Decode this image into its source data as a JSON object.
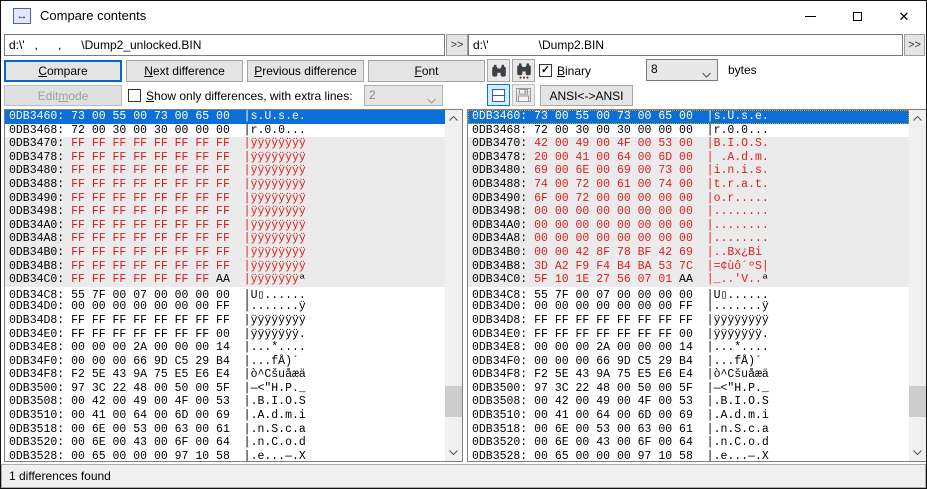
{
  "titlebar": {
    "title": "Compare contents"
  },
  "icons": {
    "compare_arrows": "↔",
    "close": "✕",
    "check": "✓",
    "chevron_down": "⌄"
  },
  "paths": {
    "left": {
      "value": "d:\\'   ,      ,      \\Dump2_unlocked.BIN",
      "expand_label": ">>"
    },
    "right": {
      "value": "d:\\'               \\Dump2.BIN",
      "expand_label": ">>"
    }
  },
  "toolbar": {
    "compare": {
      "label": "Compare",
      "m": 0
    },
    "next": {
      "label": "Next difference",
      "m": 0
    },
    "previous": {
      "label": "Previous difference",
      "m": 0
    },
    "font": {
      "label": "Font",
      "m": 0
    },
    "edit_mode": {
      "label": "Edit mode",
      "m": 5
    },
    "show_only": {
      "label": "Show only differences, with extra lines:",
      "m": 0
    },
    "show_only_checked": false,
    "extra_lines_value": "2",
    "binary": {
      "label": "Binary",
      "m": 0
    },
    "binary_checked": true,
    "bytes_value": "8",
    "bytes_label": "bytes",
    "ansi_label": "ANSI<->ANSI"
  },
  "status": {
    "text": "1 differences found"
  },
  "hex": {
    "left_rows": [
      {
        "a": "0DB3460:",
        "h": [
          [
            "73 00 55 00 73 00 65 00",
            "w"
          ]
        ],
        "t": [
          [
            "|s.U.s.e.",
            "w"
          ]
        ],
        "bg": "sel"
      },
      {
        "a": "0DB3468:",
        "h": [
          [
            "72 00 30 00 30 00 00 00",
            "k"
          ]
        ],
        "t": [
          [
            "|r.0.0...",
            "k"
          ]
        ],
        "bg": "plain"
      },
      {
        "a": "0DB3470:",
        "h": [
          [
            "FF FF FF FF FF FF FF FF",
            "r"
          ]
        ],
        "t": [
          [
            "|ÿÿÿÿÿÿÿÿ",
            "r"
          ]
        ],
        "bg": "gray"
      },
      {
        "a": "0DB3478:",
        "h": [
          [
            "FF FF FF FF FF FF FF FF",
            "r"
          ]
        ],
        "t": [
          [
            "|ÿÿÿÿÿÿÿÿ",
            "r"
          ]
        ],
        "bg": "gray"
      },
      {
        "a": "0DB3480:",
        "h": [
          [
            "FF FF FF FF FF FF FF FF",
            "r"
          ]
        ],
        "t": [
          [
            "|ÿÿÿÿÿÿÿÿ",
            "r"
          ]
        ],
        "bg": "gray"
      },
      {
        "a": "0DB3488:",
        "h": [
          [
            "FF FF FF FF FF FF FF FF",
            "r"
          ]
        ],
        "t": [
          [
            "|ÿÿÿÿÿÿÿÿ",
            "r"
          ]
        ],
        "bg": "gray"
      },
      {
        "a": "0DB3490:",
        "h": [
          [
            "FF FF FF FF FF FF FF FF",
            "r"
          ]
        ],
        "t": [
          [
            "|ÿÿÿÿÿÿÿÿ",
            "r"
          ]
        ],
        "bg": "gray"
      },
      {
        "a": "0DB3498:",
        "h": [
          [
            "FF FF FF FF FF FF FF FF",
            "r"
          ]
        ],
        "t": [
          [
            "|ÿÿÿÿÿÿÿÿ",
            "r"
          ]
        ],
        "bg": "gray"
      },
      {
        "a": "0DB34A0:",
        "h": [
          [
            "FF FF FF FF FF FF FF FF",
            "r"
          ]
        ],
        "t": [
          [
            "|ÿÿÿÿÿÿÿÿ",
            "r"
          ]
        ],
        "bg": "gray"
      },
      {
        "a": "0DB34A8:",
        "h": [
          [
            "FF FF FF FF FF FF FF FF",
            "r"
          ]
        ],
        "t": [
          [
            "|ÿÿÿÿÿÿÿÿ",
            "r"
          ]
        ],
        "bg": "gray"
      },
      {
        "a": "0DB34B0:",
        "h": [
          [
            "FF FF FF FF FF FF FF FF",
            "r"
          ]
        ],
        "t": [
          [
            "|ÿÿÿÿÿÿÿÿ",
            "r"
          ]
        ],
        "bg": "gray"
      },
      {
        "a": "0DB34B8:",
        "h": [
          [
            "FF FF FF FF FF FF FF FF",
            "r"
          ]
        ],
        "t": [
          [
            "|ÿÿÿÿÿÿÿÿ",
            "r"
          ]
        ],
        "bg": "gray"
      },
      {
        "a": "0DB34C0:",
        "h": [
          [
            "FF FF FF FF FF FF FF",
            "r"
          ],
          [
            " AA",
            "k"
          ]
        ],
        "t": [
          [
            "|ÿÿÿÿÿÿÿ",
            "r"
          ],
          [
            "ª",
            "k"
          ]
        ],
        "bg": "gray"
      },
      {
        "a": "0DB34C8:",
        "h": [
          [
            "55 7F 00 07 00 00 00 00",
            "k"
          ]
        ],
        "t": [
          [
            "|U▯......",
            "k"
          ]
        ],
        "bg": "plain"
      },
      {
        "a": "0DB34D0:",
        "h": [
          [
            "00 00 00 00 00 00 00 FF",
            "k"
          ]
        ],
        "t": [
          [
            "|.......ÿ",
            "k"
          ]
        ],
        "bg": "plain"
      },
      {
        "a": "0DB34D8:",
        "h": [
          [
            "FF FF FF FF FF FF FF FF",
            "k"
          ]
        ],
        "t": [
          [
            "|ÿÿÿÿÿÿÿÿ",
            "k"
          ]
        ],
        "bg": "plain"
      },
      {
        "a": "0DB34E0:",
        "h": [
          [
            "FF FF FF FF FF FF FF 00",
            "k"
          ]
        ],
        "t": [
          [
            "|ÿÿÿÿÿÿÿ.",
            "k"
          ]
        ],
        "bg": "plain"
      },
      {
        "a": "0DB34E8:",
        "h": [
          [
            "00 00 00 2A 00 00 00 14",
            "k"
          ]
        ],
        "t": [
          [
            "|...*....",
            "k"
          ]
        ],
        "bg": "plain"
      },
      {
        "a": "0DB34F0:",
        "h": [
          [
            "00 00 00 66 9D C5 29 B4",
            "k"
          ]
        ],
        "t": [
          [
            "|...fÅ)´",
            "k"
          ]
        ],
        "bg": "plain"
      },
      {
        "a": "0DB34F8:",
        "h": [
          [
            "F2 5E 43 9A 75 E5 E6 E4",
            "k"
          ]
        ],
        "t": [
          [
            "|ò^Cšuåæä",
            "k"
          ]
        ],
        "bg": "plain"
      },
      {
        "a": "0DB3500:",
        "h": [
          [
            "97 3C 22 48 00 50 00 5F",
            "k"
          ]
        ],
        "t": [
          [
            "|—<\"H.P._",
            "k"
          ]
        ],
        "bg": "plain"
      },
      {
        "a": "0DB3508:",
        "h": [
          [
            "00 42 00 49 00 4F 00 53",
            "k"
          ]
        ],
        "t": [
          [
            "|.B.I.O.S",
            "k"
          ]
        ],
        "bg": "plain"
      },
      {
        "a": "0DB3510:",
        "h": [
          [
            "00 41 00 64 00 6D 00 69",
            "k"
          ]
        ],
        "t": [
          [
            "|.A.d.m.i",
            "k"
          ]
        ],
        "bg": "plain"
      },
      {
        "a": "0DB3518:",
        "h": [
          [
            "00 6E 00 53 00 63 00 61",
            "k"
          ]
        ],
        "t": [
          [
            "|.n.S.c.a",
            "k"
          ]
        ],
        "bg": "plain"
      },
      {
        "a": "0DB3520:",
        "h": [
          [
            "00 6E 00 43 00 6F 00 64",
            "k"
          ]
        ],
        "t": [
          [
            "|.n.C.o.d",
            "k"
          ]
        ],
        "bg": "plain"
      },
      {
        "a": "0DB3528:",
        "h": [
          [
            "00 65 00 00 00 97 10 58",
            "k"
          ]
        ],
        "t": [
          [
            "|.e...—.X",
            "k"
          ]
        ],
        "bg": "plain"
      }
    ],
    "right_rows": [
      {
        "a": "0DB3460:",
        "h": [
          [
            "73 00 55 00 73 00 65 00",
            "w"
          ]
        ],
        "t": [
          [
            "|s.U.s.e.",
            "w"
          ]
        ],
        "bg": "sel",
        "focus": true
      },
      {
        "a": "0DB3468:",
        "h": [
          [
            "72 00 30 00 30 00 00 00",
            "k"
          ]
        ],
        "t": [
          [
            "|r.0.0...",
            "k"
          ]
        ],
        "bg": "plain"
      },
      {
        "a": "0DB3470:",
        "h": [
          [
            "42 00 49 00 4F 00 53 00",
            "r"
          ]
        ],
        "t": [
          [
            "|B.I.O.S.",
            "r"
          ]
        ],
        "bg": "gray"
      },
      {
        "a": "0DB3478:",
        "h": [
          [
            "20 00 41 00 64 00 6D 00",
            "r"
          ]
        ],
        "t": [
          [
            "| .A.d.m.",
            "r"
          ]
        ],
        "bg": "gray"
      },
      {
        "a": "0DB3480:",
        "h": [
          [
            "69 00 6E 00 69 00 73 00",
            "r"
          ]
        ],
        "t": [
          [
            "|i.n.i.s.",
            "r"
          ]
        ],
        "bg": "gray"
      },
      {
        "a": "0DB3488:",
        "h": [
          [
            "74 00 72 00 61 00 74 00",
            "r"
          ]
        ],
        "t": [
          [
            "|t.r.a.t.",
            "r"
          ]
        ],
        "bg": "gray"
      },
      {
        "a": "0DB3490:",
        "h": [
          [
            "6F 00 72 00 00 00 00 00",
            "r"
          ]
        ],
        "t": [
          [
            "|o.r.....",
            "r"
          ]
        ],
        "bg": "gray"
      },
      {
        "a": "0DB3498:",
        "h": [
          [
            "00 00 00 00 00 00 00 00",
            "r"
          ]
        ],
        "t": [
          [
            "|........",
            "r"
          ]
        ],
        "bg": "gray"
      },
      {
        "a": "0DB34A0:",
        "h": [
          [
            "00 00 00 00 00 00 00 00",
            "r"
          ]
        ],
        "t": [
          [
            "|........",
            "r"
          ]
        ],
        "bg": "gray"
      },
      {
        "a": "0DB34A8:",
        "h": [
          [
            "00 00 00 00 00 00 00 00",
            "r"
          ]
        ],
        "t": [
          [
            "|........",
            "r"
          ]
        ],
        "bg": "gray"
      },
      {
        "a": "0DB34B0:",
        "h": [
          [
            "00 00 42 8F 78 BF 42 69",
            "r"
          ]
        ],
        "t": [
          [
            "|..Bx¿Bi",
            "r"
          ]
        ],
        "bg": "gray"
      },
      {
        "a": "0DB34B8:",
        "h": [
          [
            "3D A2 F9 F4 B4 BA 53 7C",
            "r"
          ]
        ],
        "t": [
          [
            "|=¢ùô´ºS|",
            "r"
          ]
        ],
        "bg": "gray"
      },
      {
        "a": "0DB34C0:",
        "h": [
          [
            "5F 10 1E 27 56 07 01",
            "r"
          ],
          [
            " AA",
            "k"
          ]
        ],
        "t": [
          [
            "|_..'V..",
            "r"
          ],
          [
            "ª",
            "k"
          ]
        ],
        "bg": "gray"
      },
      {
        "a": "0DB34C8:",
        "h": [
          [
            "55 7F 00 07 00 00 00 00",
            "k"
          ]
        ],
        "t": [
          [
            "|U▯......",
            "k"
          ]
        ],
        "bg": "plain"
      },
      {
        "a": "0DB34D0:",
        "h": [
          [
            "00 00 00 00 00 00 00 FF",
            "k"
          ]
        ],
        "t": [
          [
            "|.......ÿ",
            "k"
          ]
        ],
        "bg": "plain"
      },
      {
        "a": "0DB34D8:",
        "h": [
          [
            "FF FF FF FF FF FF FF FF",
            "k"
          ]
        ],
        "t": [
          [
            "|ÿÿÿÿÿÿÿÿ",
            "k"
          ]
        ],
        "bg": "plain"
      },
      {
        "a": "0DB34E0:",
        "h": [
          [
            "FF FF FF FF FF FF FF 00",
            "k"
          ]
        ],
        "t": [
          [
            "|ÿÿÿÿÿÿÿ.",
            "k"
          ]
        ],
        "bg": "plain"
      },
      {
        "a": "0DB34E8:",
        "h": [
          [
            "00 00 00 2A 00 00 00 14",
            "k"
          ]
        ],
        "t": [
          [
            "|...*....",
            "k"
          ]
        ],
        "bg": "plain"
      },
      {
        "a": "0DB34F0:",
        "h": [
          [
            "00 00 00 66 9D C5 29 B4",
            "k"
          ]
        ],
        "t": [
          [
            "|...fÅ)´",
            "k"
          ]
        ],
        "bg": "plain"
      },
      {
        "a": "0DB34F8:",
        "h": [
          [
            "F2 5E 43 9A 75 E5 E6 E4",
            "k"
          ]
        ],
        "t": [
          [
            "|ò^Cšuåæä",
            "k"
          ]
        ],
        "bg": "plain"
      },
      {
        "a": "0DB3500:",
        "h": [
          [
            "97 3C 22 48 00 50 00 5F",
            "k"
          ]
        ],
        "t": [
          [
            "|—<\"H.P._",
            "k"
          ]
        ],
        "bg": "plain"
      },
      {
        "a": "0DB3508:",
        "h": [
          [
            "00 42 00 49 00 4F 00 53",
            "k"
          ]
        ],
        "t": [
          [
            "|.B.I.O.S",
            "k"
          ]
        ],
        "bg": "plain"
      },
      {
        "a": "0DB3510:",
        "h": [
          [
            "00 41 00 64 00 6D 00 69",
            "k"
          ]
        ],
        "t": [
          [
            "|.A.d.m.i",
            "k"
          ]
        ],
        "bg": "plain"
      },
      {
        "a": "0DB3518:",
        "h": [
          [
            "00 6E 00 53 00 63 00 61",
            "k"
          ]
        ],
        "t": [
          [
            "|.n.S.c.a",
            "k"
          ]
        ],
        "bg": "plain"
      },
      {
        "a": "0DB3520:",
        "h": [
          [
            "00 6E 00 43 00 6F 00 64",
            "k"
          ]
        ],
        "t": [
          [
            "|.n.C.o.d",
            "k"
          ]
        ],
        "bg": "plain"
      },
      {
        "a": "0DB3528:",
        "h": [
          [
            "00 65 00 00 00 97 10 58",
            "k"
          ]
        ],
        "t": [
          [
            "|.e...—.X",
            "k"
          ]
        ],
        "bg": "plain"
      }
    ]
  }
}
